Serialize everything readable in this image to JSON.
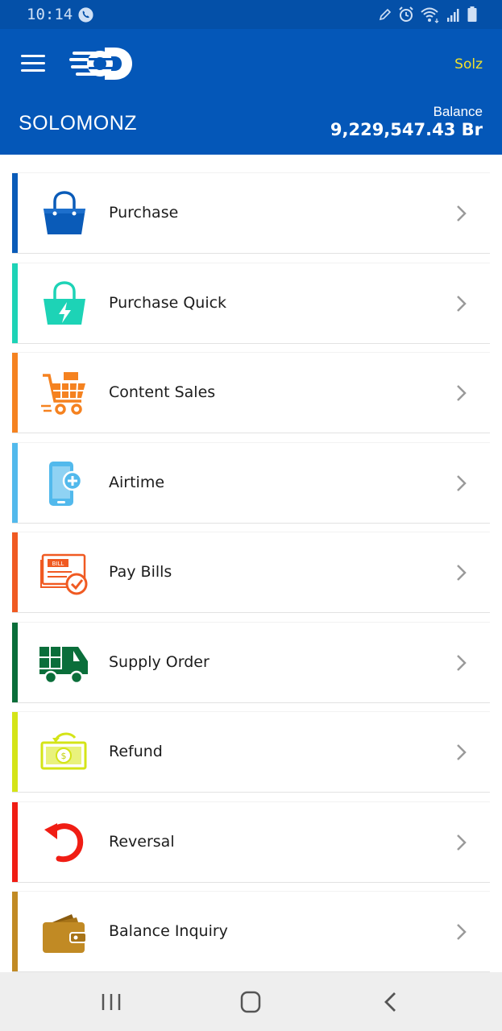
{
  "status_bar": {
    "time": "10:14",
    "icons": [
      "viber-icon",
      "pen-icon",
      "alarm-icon",
      "wifi-icon",
      "signal-icon",
      "battery-icon"
    ]
  },
  "header": {
    "menu_icon": "hamburger-menu-icon",
    "logo": "brand-logo",
    "username": "Solz",
    "account_name": "SOLOMONZ",
    "balance_label": "Balance",
    "balance_value": "9,229,547.43 Br"
  },
  "menu": {
    "items": [
      {
        "label": "Purchase",
        "icon": "shopping-bag-icon",
        "color": "#0a5bb8"
      },
      {
        "label": "Purchase Quick",
        "icon": "quick-bag-icon",
        "color": "#1dd3b6"
      },
      {
        "label": "Content Sales",
        "icon": "cart-icon",
        "color": "#f58220"
      },
      {
        "label": "Airtime",
        "icon": "phone-plus-icon",
        "color": "#52b9ec"
      },
      {
        "label": "Pay Bills",
        "icon": "bill-icon",
        "color": "#f05a22"
      },
      {
        "label": "Supply Order",
        "icon": "truck-icon",
        "color": "#0a6e3a"
      },
      {
        "label": "Refund",
        "icon": "money-refund-icon",
        "color": "#d4e417"
      },
      {
        "label": "Reversal",
        "icon": "reverse-arrow-icon",
        "color": "#f01d14"
      },
      {
        "label": "Balance Inquiry",
        "icon": "wallet-icon",
        "color": "#c18a24"
      }
    ],
    "chevron_icon": "chevron-right-icon"
  },
  "nav_bar": {
    "buttons": [
      "recent-apps-icon",
      "home-icon",
      "back-icon"
    ]
  }
}
